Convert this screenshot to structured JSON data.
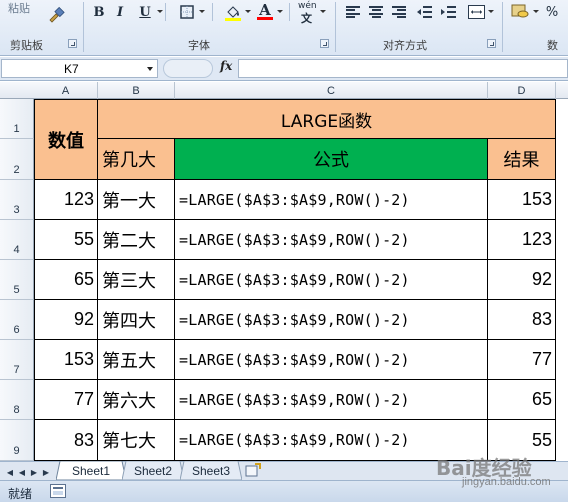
{
  "ribbon": {
    "clipboard": {
      "label": "剪贴板",
      "paste_label": "粘贴"
    },
    "font": {
      "label": "字体",
      "bold": "B",
      "italic": "I",
      "underline": "U",
      "font_color_glyph": "A",
      "phonetic_glyph": "wén"
    },
    "alignment": {
      "label": "对齐方式"
    },
    "number": {
      "label": "数字",
      "percent": "%"
    }
  },
  "formula_bar": {
    "name_box": "K7",
    "fx": "fx",
    "formula": ""
  },
  "columns": [
    "A",
    "B",
    "C",
    "D"
  ],
  "rows": [
    "1",
    "2",
    "3",
    "4",
    "5",
    "6",
    "7",
    "8",
    "9"
  ],
  "table": {
    "header_value": "数值",
    "header_title": "LARGE函数",
    "header_rank": "第几大",
    "header_formula": "公式",
    "header_result": "结果",
    "records": [
      {
        "value": "123",
        "rank": "第一大",
        "formula": "=LARGE($A$3:$A$9,ROW()-2)",
        "result": "153"
      },
      {
        "value": "55",
        "rank": "第二大",
        "formula": "=LARGE($A$3:$A$9,ROW()-2)",
        "result": "123"
      },
      {
        "value": "65",
        "rank": "第三大",
        "formula": "=LARGE($A$3:$A$9,ROW()-2)",
        "result": "92"
      },
      {
        "value": "92",
        "rank": "第四大",
        "formula": "=LARGE($A$3:$A$9,ROW()-2)",
        "result": "83"
      },
      {
        "value": "153",
        "rank": "第五大",
        "formula": "=LARGE($A$3:$A$9,ROW()-2)",
        "result": "77"
      },
      {
        "value": "77",
        "rank": "第六大",
        "formula": "=LARGE($A$3:$A$9,ROW()-2)",
        "result": "65"
      },
      {
        "value": "83",
        "rank": "第七大",
        "formula": "=LARGE($A$3:$A$9,ROW()-2)",
        "result": "55"
      }
    ]
  },
  "colors": {
    "header_orange": "#fac090",
    "header_green": "#00b050"
  },
  "sheet_tabs": [
    "Sheet1",
    "Sheet2",
    "Sheet3"
  ],
  "status": {
    "text": "就绪"
  },
  "watermark": {
    "brand": "Bai度经验",
    "url": "jingyan.baidu.com"
  }
}
